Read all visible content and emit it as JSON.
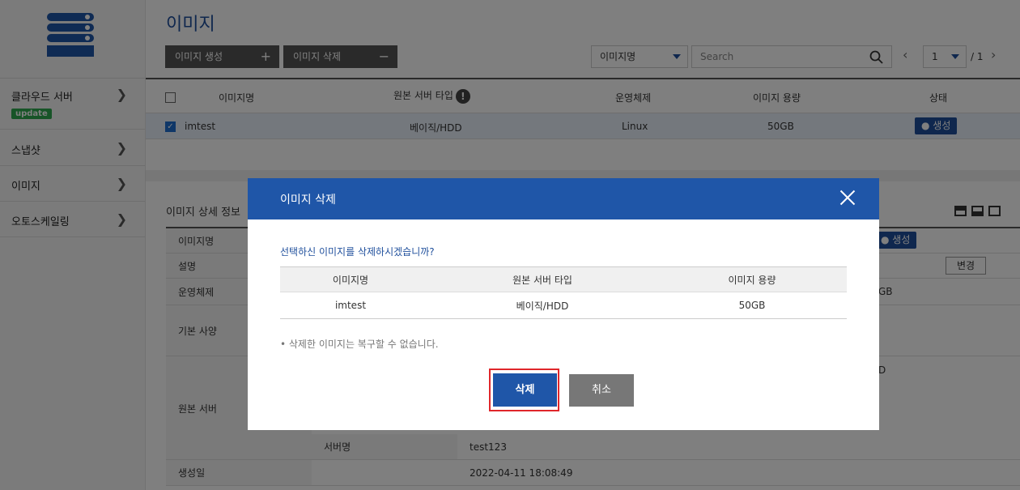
{
  "sidebar": {
    "items": [
      {
        "label": "클라우드 서버",
        "badge": "update"
      },
      {
        "label": "스냅샷"
      },
      {
        "label": "이미지"
      },
      {
        "label": "오토스케일링"
      }
    ]
  },
  "header": {
    "title": "이미지",
    "create_label": "이미지 생성",
    "create_symbol": "+",
    "delete_label": "이미지 삭제",
    "delete_symbol": "−",
    "filter_select": "이미지명",
    "search_placeholder": "Search",
    "page_current": "1",
    "page_total": "/ 1"
  },
  "list": {
    "columns": [
      "이미지명",
      "원본 서버 타입",
      "운영체제",
      "이미지 용량",
      "상태"
    ],
    "info_mark": "!",
    "rows": [
      {
        "name": "imtest",
        "server_type": "베이직/HDD",
        "os": "Linux",
        "size": "50GB",
        "status": "● 생성"
      }
    ]
  },
  "detail": {
    "title": "이미지 상세 정보",
    "edit_label": "변경",
    "status": "● 생성",
    "os_value_fragment": "GB",
    "origin_fragment": "D",
    "rows": {
      "name_label": "이미지명",
      "desc_label": "설명",
      "os_label": "운영체제",
      "spec_label": "기본 사양",
      "origin_label": "원본 서버",
      "server_name_label": "서버명",
      "server_name_value": "test123",
      "created_label": "생성일",
      "created_value": "2022-04-11 18:08:49"
    }
  },
  "modal": {
    "title": "이미지 삭제",
    "message": "선택하신 이미지를 삭제하시겠습니까?",
    "columns": [
      "이미지명",
      "원본 서버 타입",
      "이미지 용량"
    ],
    "row": {
      "name": "imtest",
      "server_type": "베이직/HDD",
      "size": "50GB"
    },
    "note": "• 삭제한 이미지는 복구할 수 없습니다.",
    "confirm_label": "삭제",
    "cancel_label": "취소"
  },
  "colors": {
    "primary": "#1f56a8",
    "title_blue": "#1f4f9c",
    "highlight_red": "#e0262b",
    "badge_green": "#2fa84f"
  }
}
